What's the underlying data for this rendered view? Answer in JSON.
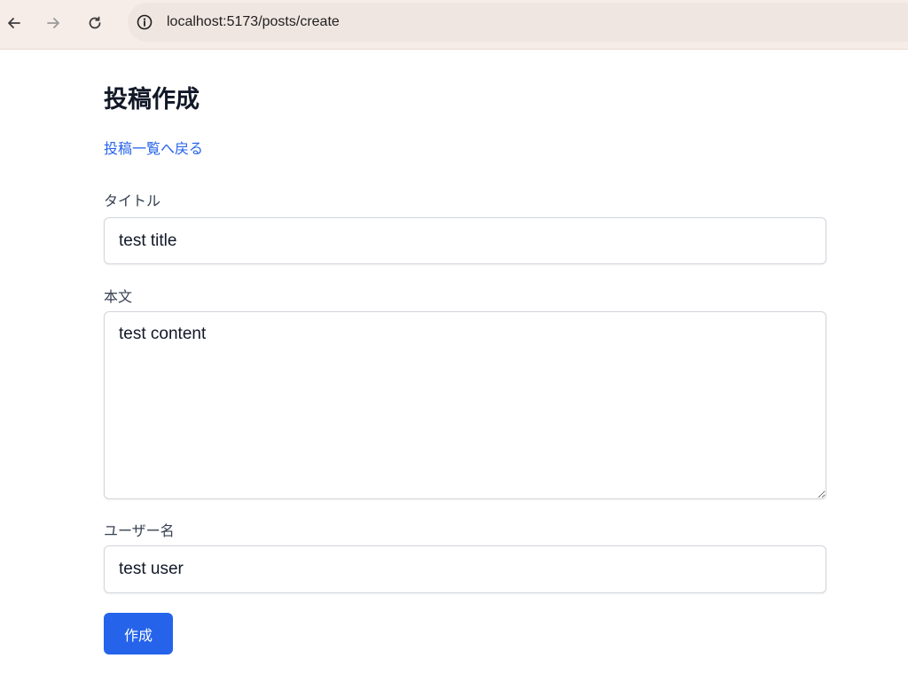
{
  "browser": {
    "url": "localhost:5173/posts/create",
    "icons": [
      "back-arrow-icon",
      "forward-arrow-icon",
      "reload-icon",
      "info-icon"
    ]
  },
  "page": {
    "title": "投稿作成",
    "back_link": "投稿一覧へ戻る"
  },
  "form": {
    "title_label": "タイトル",
    "title_value": "test title",
    "body_label": "本文",
    "body_value": "test content",
    "username_label": "ユーザー名",
    "username_value": "test user",
    "submit_label": "作成"
  },
  "colors": {
    "accent": "#2563eb",
    "toolbar_bg": "#f6ece8"
  }
}
